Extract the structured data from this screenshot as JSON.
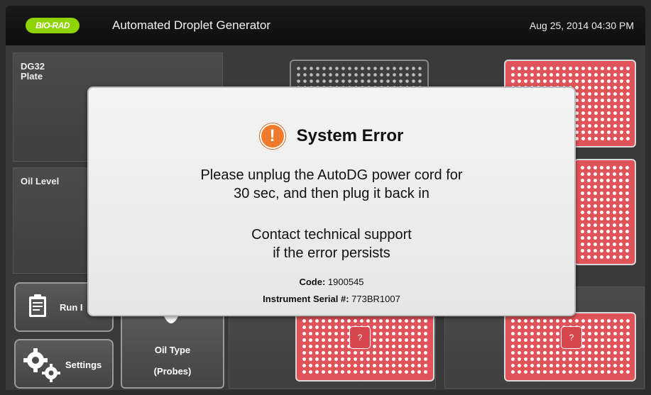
{
  "header": {
    "logo_text": "BIO-RAD",
    "title": "Automated Droplet Generator",
    "datetime": "Aug 25, 2014 04:30 PM"
  },
  "panels": {
    "plate_label_1": "DG32",
    "plate_label_2": "Plate",
    "oil_label": "Oil Level"
  },
  "buttons": {
    "run_label": "Run I",
    "settings_label": "Settings",
    "oil_type_line1": "Oil Type",
    "oil_type_line2": "(Probes)"
  },
  "plates": {
    "question_mark": "?"
  },
  "dialog": {
    "title": "System Error",
    "message_line1": "Please unplug the AutoDG power cord for",
    "message_line2": "30 sec, and then plug it back in",
    "message_line3": "Contact technical support",
    "message_line4": "if the error persists",
    "code_label": "Code:",
    "code_value": "1900545",
    "serial_label": "Instrument Serial #:",
    "serial_value": "773BR1007"
  },
  "colors": {
    "accent_red": "#e0535a",
    "logo_green": "#8fd400",
    "warning_orange": "#ee7b2b"
  }
}
